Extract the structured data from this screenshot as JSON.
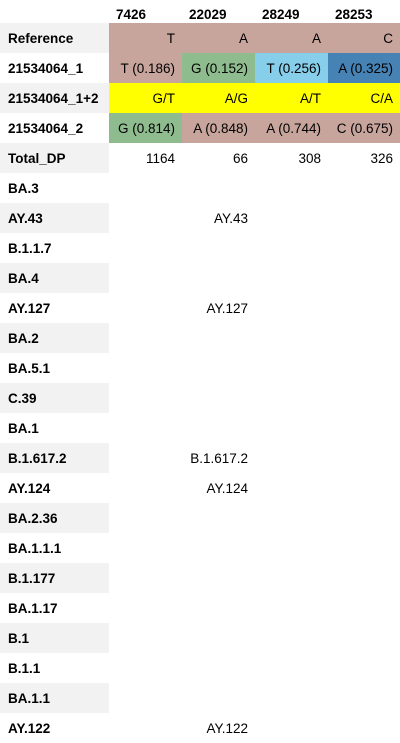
{
  "positions": [
    "7426",
    "22029",
    "28249",
    "28253"
  ],
  "rows": {
    "reference": {
      "label": "Reference",
      "cells": [
        "T",
        "A",
        "A",
        "C"
      ]
    },
    "sample1": {
      "label": "21534064_1",
      "cells": [
        "T (0.186)",
        "G (0.152)",
        "T (0.256)",
        "A (0.325)"
      ]
    },
    "combined": {
      "label": "21534064_1+2",
      "cells": [
        "G/T",
        "A/G",
        "A/T",
        "C/A"
      ]
    },
    "sample2": {
      "label": "21534064_2",
      "cells": [
        "G (0.814)",
        "A (0.848)",
        "A (0.744)",
        "C (0.675)"
      ]
    },
    "total_dp": {
      "label": "Total_DP",
      "cells": [
        "1164",
        "66",
        "308",
        "326"
      ]
    }
  },
  "lineages": [
    {
      "label": "BA.3",
      "hit": ""
    },
    {
      "label": "AY.43",
      "hit": "AY.43"
    },
    {
      "label": "B.1.1.7",
      "hit": ""
    },
    {
      "label": "BA.4",
      "hit": ""
    },
    {
      "label": "AY.127",
      "hit": "AY.127"
    },
    {
      "label": "BA.2",
      "hit": ""
    },
    {
      "label": "BA.5.1",
      "hit": ""
    },
    {
      "label": "C.39",
      "hit": ""
    },
    {
      "label": "BA.1",
      "hit": ""
    },
    {
      "label": "B.1.617.2",
      "hit": "B.1.617.2"
    },
    {
      "label": "AY.124",
      "hit": "AY.124"
    },
    {
      "label": "BA.2.36",
      "hit": ""
    },
    {
      "label": "BA.1.1.1",
      "hit": ""
    },
    {
      "label": "B.1.177",
      "hit": ""
    },
    {
      "label": "BA.1.17",
      "hit": ""
    },
    {
      "label": "B.1",
      "hit": ""
    },
    {
      "label": "B.1.1",
      "hit": ""
    },
    {
      "label": "BA.1.1",
      "hit": ""
    },
    {
      "label": "AY.122",
      "hit": "AY.122"
    }
  ],
  "colors": {
    "reference": "#c8a59c",
    "ref_match": "#c8a59c",
    "allele_G": "#8fbc8f",
    "allele_T_light": "#87ceeb",
    "allele_A_dark": "#4682b4",
    "combined": "#ffff00",
    "label_stripe": "#f2f2f2"
  }
}
